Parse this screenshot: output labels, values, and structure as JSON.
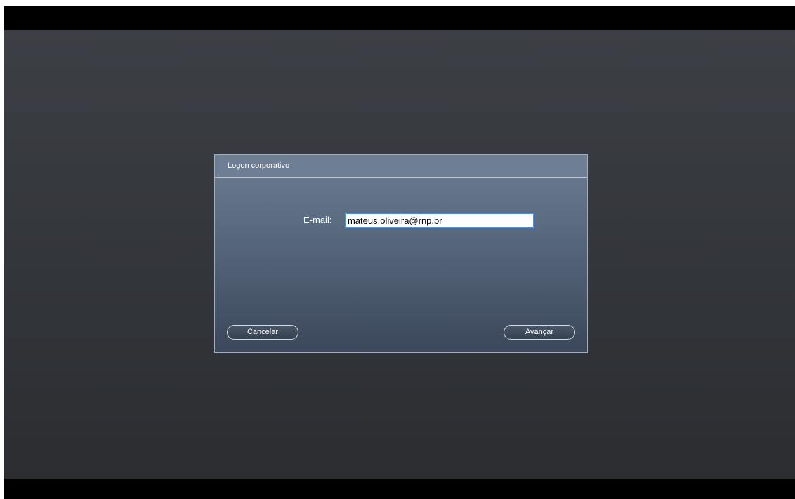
{
  "dialog": {
    "title": "Logon corporativo",
    "email_label": "E-mail:",
    "email_value": "mateus.oliveira@rnp.br",
    "cancel_label": "Cancelar",
    "next_label": "Avançar"
  }
}
